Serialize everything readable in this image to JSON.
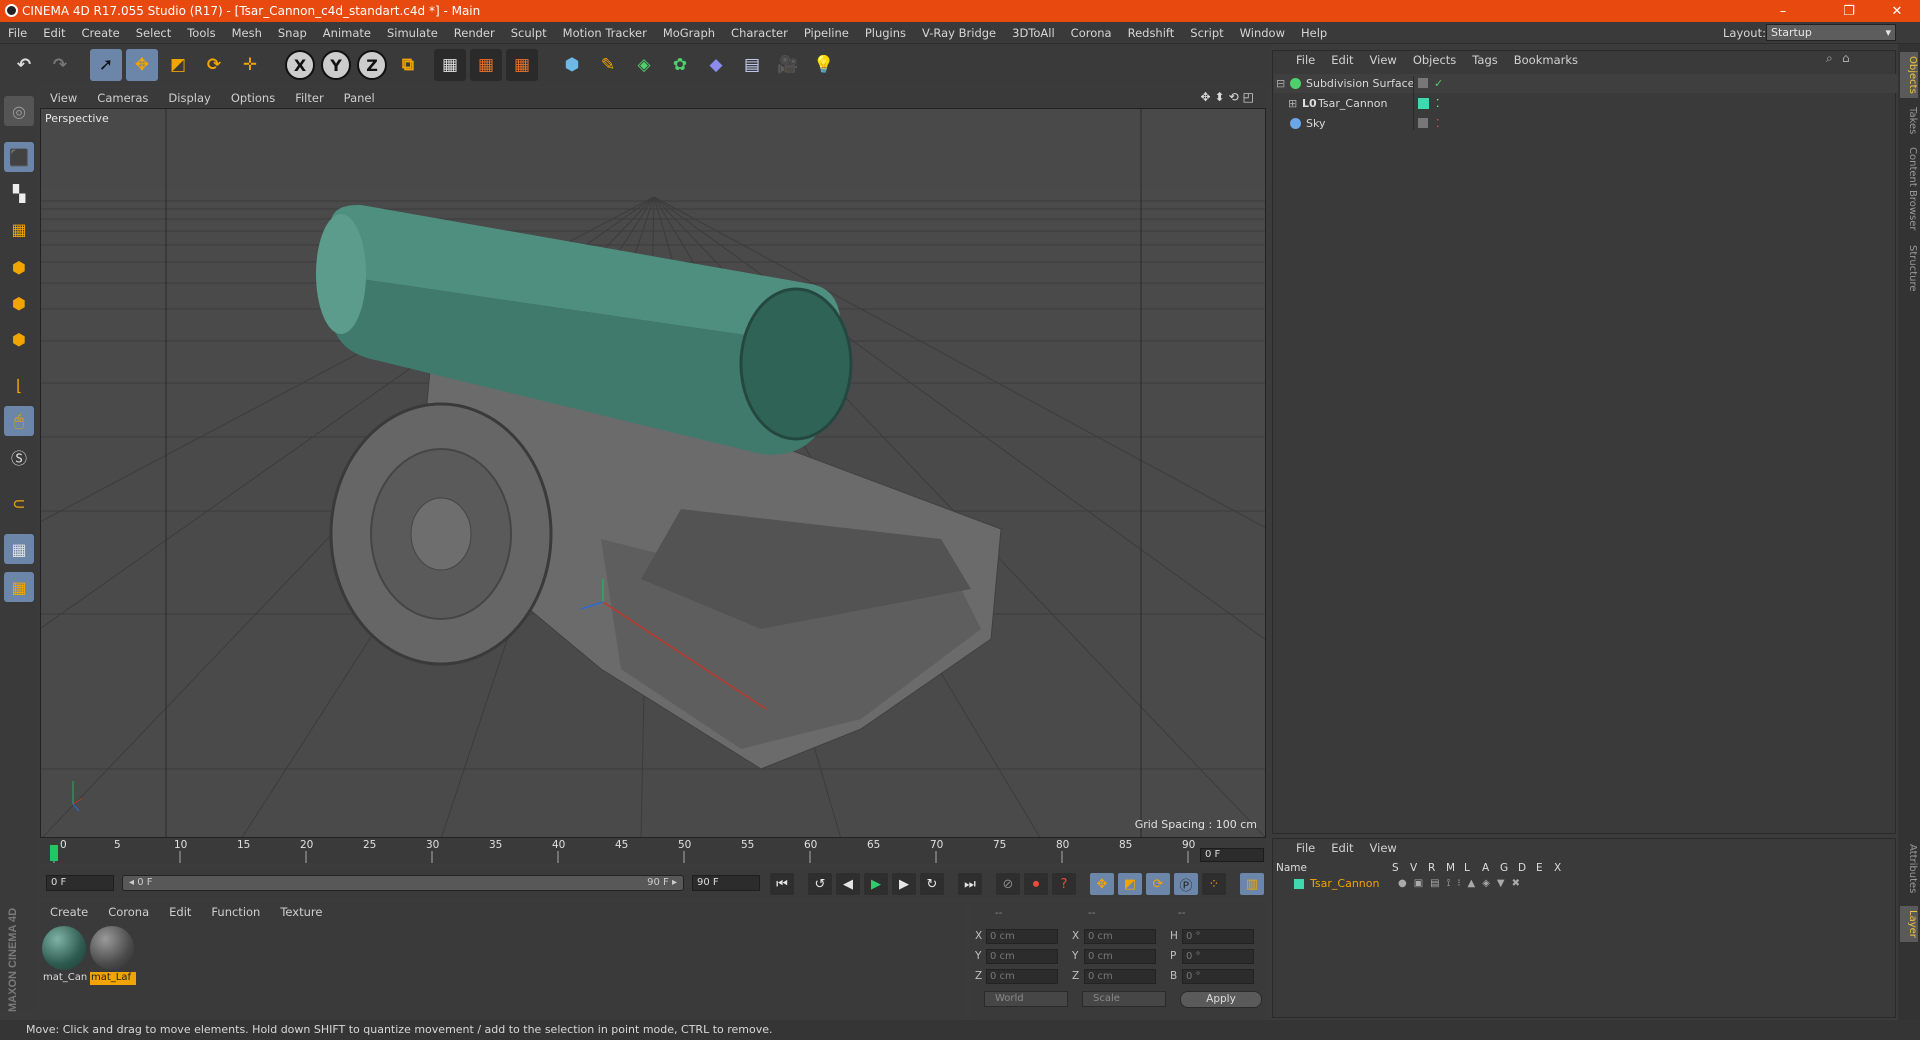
{
  "window": {
    "title": "CINEMA 4D R17.055 Studio (R17) - [Tsar_Cannon_c4d_standart.c4d *] - Main",
    "controls": [
      "–",
      "❐",
      "✕"
    ]
  },
  "menubar": {
    "items": [
      "File",
      "Edit",
      "Create",
      "Select",
      "Tools",
      "Mesh",
      "Snap",
      "Animate",
      "Simulate",
      "Render",
      "Sculpt",
      "Motion Tracker",
      "MoGraph",
      "Character",
      "Pipeline",
      "Plugins",
      "V-Ray Bridge",
      "3DToAll",
      "Corona",
      "Redshift",
      "Script",
      "Window",
      "Help"
    ],
    "layout_label": "Layout:",
    "layout_value": "Startup"
  },
  "toolbar": {
    "axis_x": "X",
    "axis_y": "Y",
    "axis_z": "Z"
  },
  "viewport": {
    "menu": [
      "View",
      "Cameras",
      "Display",
      "Options",
      "Filter",
      "Panel"
    ],
    "label": "Perspective",
    "grid_spacing": "Grid Spacing : 100 cm",
    "nav_icons": "✥⬍⟲◰"
  },
  "timeline": {
    "ticks": [
      "0",
      "5",
      "10",
      "15",
      "20",
      "25",
      "30",
      "35",
      "40",
      "45",
      "50",
      "55",
      "60",
      "65",
      "70",
      "75",
      "80",
      "85",
      "90"
    ],
    "current_frame": "0 F"
  },
  "playback": {
    "start_field": "0 F",
    "range_start": "◂ 0 F",
    "range_end": "90 F ▸",
    "end_field": "90 F"
  },
  "material_panel": {
    "menu": [
      "Create",
      "Corona",
      "Edit",
      "Function",
      "Texture"
    ],
    "materials": [
      {
        "name": "mat_Can",
        "color": "#3f6f64",
        "selected": false
      },
      {
        "name": "mat_Laf",
        "color": "#5a5a5a",
        "selected": true
      }
    ]
  },
  "coords": {
    "headers": [
      "--",
      "--",
      "--"
    ],
    "rows": [
      {
        "a": "X",
        "av": "0 cm",
        "b": "X",
        "bv": "0 cm",
        "c": "H",
        "cv": "0 °"
      },
      {
        "a": "Y",
        "av": "0 cm",
        "b": "Y",
        "bv": "0 cm",
        "c": "P",
        "cv": "0 °"
      },
      {
        "a": "Z",
        "av": "0 cm",
        "b": "Z",
        "bv": "0 cm",
        "c": "B",
        "cv": "0 °"
      }
    ],
    "world": "World",
    "scale": "Scale",
    "apply": "Apply"
  },
  "object_manager": {
    "menu": [
      "File",
      "Edit",
      "View",
      "Objects",
      "Tags",
      "Bookmarks"
    ],
    "objects": [
      {
        "name": "Subdivision Surface",
        "level": 0
      },
      {
        "name": "Tsar_Cannon",
        "level": 1
      },
      {
        "name": "Sky",
        "level": 0
      }
    ]
  },
  "layer_manager": {
    "menu": [
      "File",
      "Edit",
      "View"
    ],
    "columns": [
      "Name",
      "S",
      "V",
      "R",
      "M",
      "L",
      "A",
      "G",
      "D",
      "E",
      "X"
    ],
    "layers": [
      {
        "name": "Tsar_Cannon",
        "color": "#3fd9b0"
      }
    ]
  },
  "right_tabs": [
    "Objects",
    "Takes",
    "Content Browser",
    "Structure",
    "Attributes",
    "Layer"
  ],
  "status": "Move: Click and drag to move elements. Hold down SHIFT to quantize movement / add to the selection in point mode, CTRL to remove.",
  "brand": "MAXON CINEMA 4D"
}
